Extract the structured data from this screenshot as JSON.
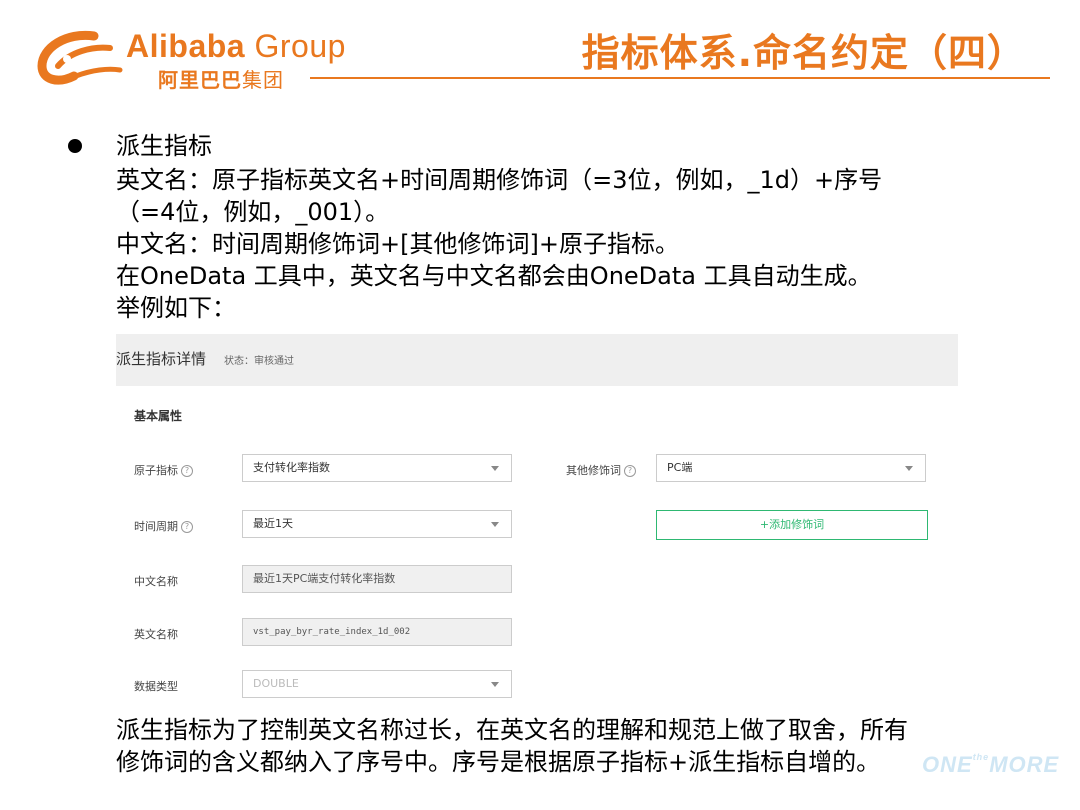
{
  "header": {
    "logo_en_main": "Alibaba",
    "logo_en_group": "Group",
    "logo_cn_main": "阿里巴巴",
    "logo_cn_tail": "集团",
    "title": "指标体系.命名约定（四）",
    "accent_color": "#e9781f"
  },
  "content": {
    "bullet_heading": "派生指标",
    "line1": "英文名：原子指标英文名+时间周期修饰词（=3位，例如，_1d）+序号",
    "line2": "（=4位，例如，_001）。",
    "line3": "中文名：时间周期修饰词+[其他修饰词]+原子指标。",
    "line4": "在OneData 工具中，英文名与中文名都会由OneData 工具自动生成。",
    "line5": "举例如下：",
    "footer1": "派生指标为了控制英文名称过长，在英文名的理解和规范上做了取舍，所有",
    "footer2": "修饰词的含义都纳入了序号中。序号是根据原子指标+派生指标自增的。"
  },
  "example": {
    "title": "派生指标详情",
    "status": "状态：审核通过",
    "section": "基本属性",
    "atomic_label": "原子指标",
    "atomic_value": "支付转化率指数",
    "other_mod_label": "其他修饰词",
    "other_mod_value": "PC端",
    "time_label": "时间周期",
    "time_value": "最近1天",
    "add_button": "+添加修饰词",
    "cn_name_label": "中文名称",
    "cn_name_value": "最近1天PC端支付转化率指数",
    "en_name_label": "英文名称",
    "en_name_value": "vst_pay_byr_rate_index_1d_002",
    "type_label": "数据类型",
    "type_value": "DOUBLE",
    "help_glyph": "?",
    "accent_green": "#2eb872"
  },
  "watermark": {
    "part1": "ONE",
    "small": "the",
    "part2": "MORE"
  }
}
